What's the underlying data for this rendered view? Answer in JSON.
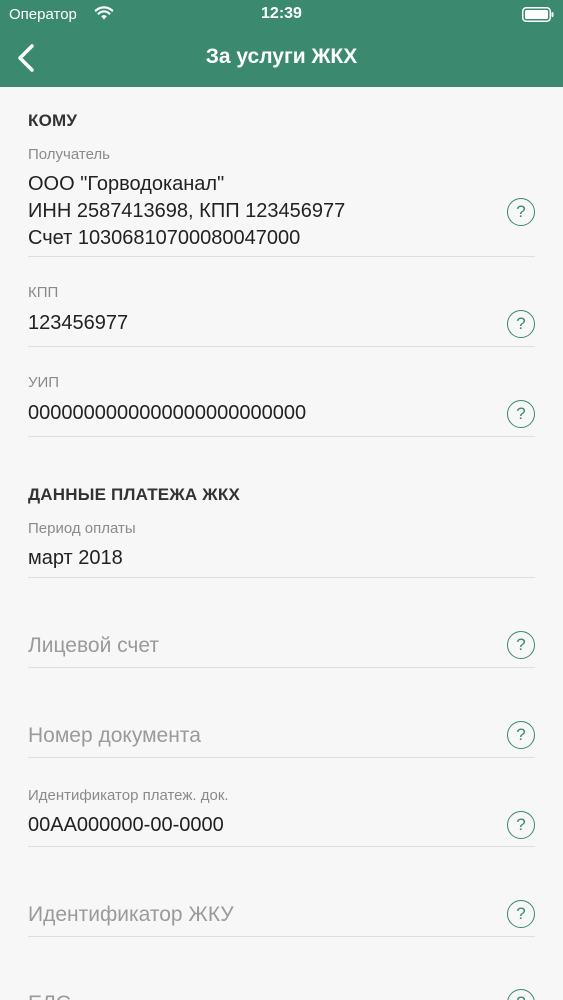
{
  "status_bar": {
    "carrier": "Оператор",
    "time": "12:39"
  },
  "nav": {
    "title": "За услуги ЖКХ",
    "back_icon": "chevron-left-icon"
  },
  "sections": {
    "to": {
      "title": "КОМУ"
    },
    "payment": {
      "title": "ДАННЫЕ ПЛАТЕЖА ЖКХ"
    }
  },
  "fields": {
    "recipient": {
      "label": "Получатель",
      "line1": "ООО \"Горводоканал\"",
      "line2": "ИНН 2587413698, КПП 123456977",
      "line3": "Счет 10306810700080047000"
    },
    "kpp": {
      "label": "КПП",
      "value": "123456977"
    },
    "uip": {
      "label": "УИП",
      "value": "0000000000000000000000000"
    },
    "period": {
      "label": "Период оплаты",
      "value": "март 2018"
    },
    "account": {
      "placeholder": "Лицевой счет"
    },
    "doc_number": {
      "placeholder": "Номер документа"
    },
    "doc_id": {
      "label": "Идентификатор платеж. док.",
      "value": "00АА000000-00-0000"
    },
    "zhku_id": {
      "placeholder": "Идентификатор ЖКУ"
    },
    "elo": {
      "placeholder": "ЕЛС"
    }
  },
  "help_icon_glyph": "?",
  "colors": {
    "accent": "#3b8a6f",
    "background": "#f7f7f7"
  }
}
